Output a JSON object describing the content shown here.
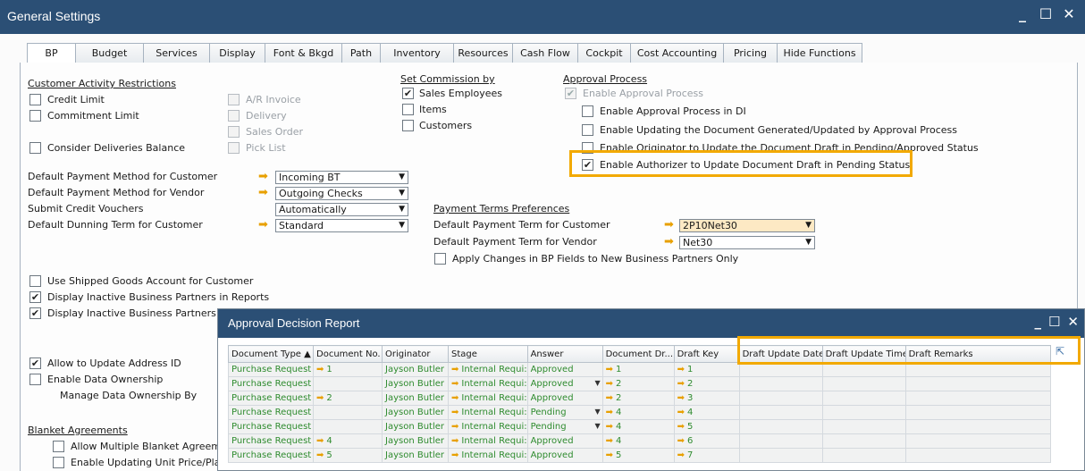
{
  "window": {
    "title": "General Settings",
    "controls": [
      "_",
      "☐",
      "✕"
    ]
  },
  "tabs": [
    {
      "label": "BP",
      "active": true
    },
    {
      "label": "Budget"
    },
    {
      "label": "Services"
    },
    {
      "label": "Display"
    },
    {
      "label": "Font & Bkgd"
    },
    {
      "label": "Path"
    },
    {
      "label": "Inventory"
    },
    {
      "label": "Resources"
    },
    {
      "label": "Cash Flow"
    },
    {
      "label": "Cockpit"
    },
    {
      "label": "Cost Accounting"
    },
    {
      "label": "Pricing"
    },
    {
      "label": "Hide Functions"
    }
  ],
  "customer_activity": {
    "title": "Customer Activity Restrictions",
    "credit_limit": "Credit Limit",
    "commitment_limit": "Commitment Limit",
    "consider_deliveries": "Consider Deliveries Balance",
    "ar_invoice": "A/R Invoice",
    "delivery": "Delivery",
    "sales_order": "Sales Order",
    "pick_list": "Pick List"
  },
  "commission": {
    "title": "Set Commission by",
    "sales_employees": "Sales Employees",
    "items": "Items",
    "customers": "Customers"
  },
  "approval": {
    "title": "Approval Process",
    "enable": "Enable Approval Process",
    "enable_di": "Enable Approval Process in DI",
    "enable_updating": "Enable Updating the Document Generated/Updated by Approval Process",
    "enable_originator": "Enable Originator to Update the Document Draft in Pending/Approved Status",
    "enable_authorizer": "Enable Authorizer to Update Document Draft in Pending Status"
  },
  "defaults": {
    "pay_cust_label": "Default Payment Method for Customer",
    "pay_cust_value": "Incoming BT",
    "pay_vend_label": "Default Payment Method for Vendor",
    "pay_vend_value": "Outgoing Checks",
    "credit_vouchers_label": "Submit Credit Vouchers",
    "credit_vouchers_value": "Automatically",
    "dunning_label": "Default Dunning Term for Customer",
    "dunning_value": "Standard"
  },
  "payment_terms": {
    "title": "Payment Terms Preferences",
    "cust_label": "Default Payment Term for Customer",
    "cust_value": "2P10Net30",
    "vend_label": "Default Payment Term for Vendor",
    "vend_value": "Net30",
    "apply_changes": "Apply Changes in BP Fields to New Business Partners Only"
  },
  "bp_options": {
    "shipped_goods": "Use Shipped Goods Account for Customer",
    "inactive_reports": "Display Inactive Business Partners in Reports",
    "inactive_in": "Display Inactive Business Partners in",
    "allow_address": "Allow to Update Address ID",
    "enable_ownership": "Enable Data Ownership",
    "manage_ownership": "Manage Data Ownership By"
  },
  "blanket": {
    "title": "Blanket Agreements",
    "allow_multiple": "Allow Multiple Blanket Agreemen",
    "enable_updating": "Enable Updating Unit Price/Plann"
  },
  "report": {
    "title": "Approval Decision Report",
    "columns": [
      "Document Type ▲",
      "Document No.",
      "Originator",
      "Stage",
      "Answer",
      "Document Dr...",
      "Draft Key",
      "Draft Update Date",
      "Draft Update Time",
      "Draft Remarks"
    ],
    "rows": [
      {
        "type": "Purchase Request",
        "doc_no": "1",
        "originator": "Jayson Butler",
        "stage": "Internal Requi:",
        "answer": "Approved",
        "ddd": false,
        "draft": "1",
        "key": "1"
      },
      {
        "type": "Purchase Request",
        "doc_no": "",
        "originator": "Jayson Butler",
        "stage": "Internal Requi:",
        "answer": "Approved",
        "ddd": true,
        "draft": "2",
        "key": "2"
      },
      {
        "type": "Purchase Request",
        "doc_no": "2",
        "originator": "Jayson Butler",
        "stage": "Internal Requi:",
        "answer": "Approved",
        "ddd": false,
        "draft": "2",
        "key": "3"
      },
      {
        "type": "Purchase Request",
        "doc_no": "",
        "originator": "Jayson Butler",
        "stage": "Internal Requi:",
        "answer": "Pending",
        "ddd": true,
        "draft": "4",
        "key": "4"
      },
      {
        "type": "Purchase Request",
        "doc_no": "",
        "originator": "Jayson Butler",
        "stage": "Internal Requi:",
        "answer": "Pending",
        "ddd": true,
        "draft": "4",
        "key": "5"
      },
      {
        "type": "Purchase Request",
        "doc_no": "4",
        "originator": "Jayson Butler",
        "stage": "Internal Requi:",
        "answer": "Approved",
        "ddd": false,
        "draft": "4",
        "key": "6"
      },
      {
        "type": "Purchase Request",
        "doc_no": "5",
        "originator": "Jayson Butler",
        "stage": "Internal Requi:",
        "answer": "Approved",
        "ddd": false,
        "draft": "5",
        "key": "7"
      }
    ]
  },
  "colors": {
    "title_bar": "#2b4f75",
    "highlight": "#f2a900",
    "link_arrow": "#e8a000",
    "green_text": "#2e8b2e"
  }
}
